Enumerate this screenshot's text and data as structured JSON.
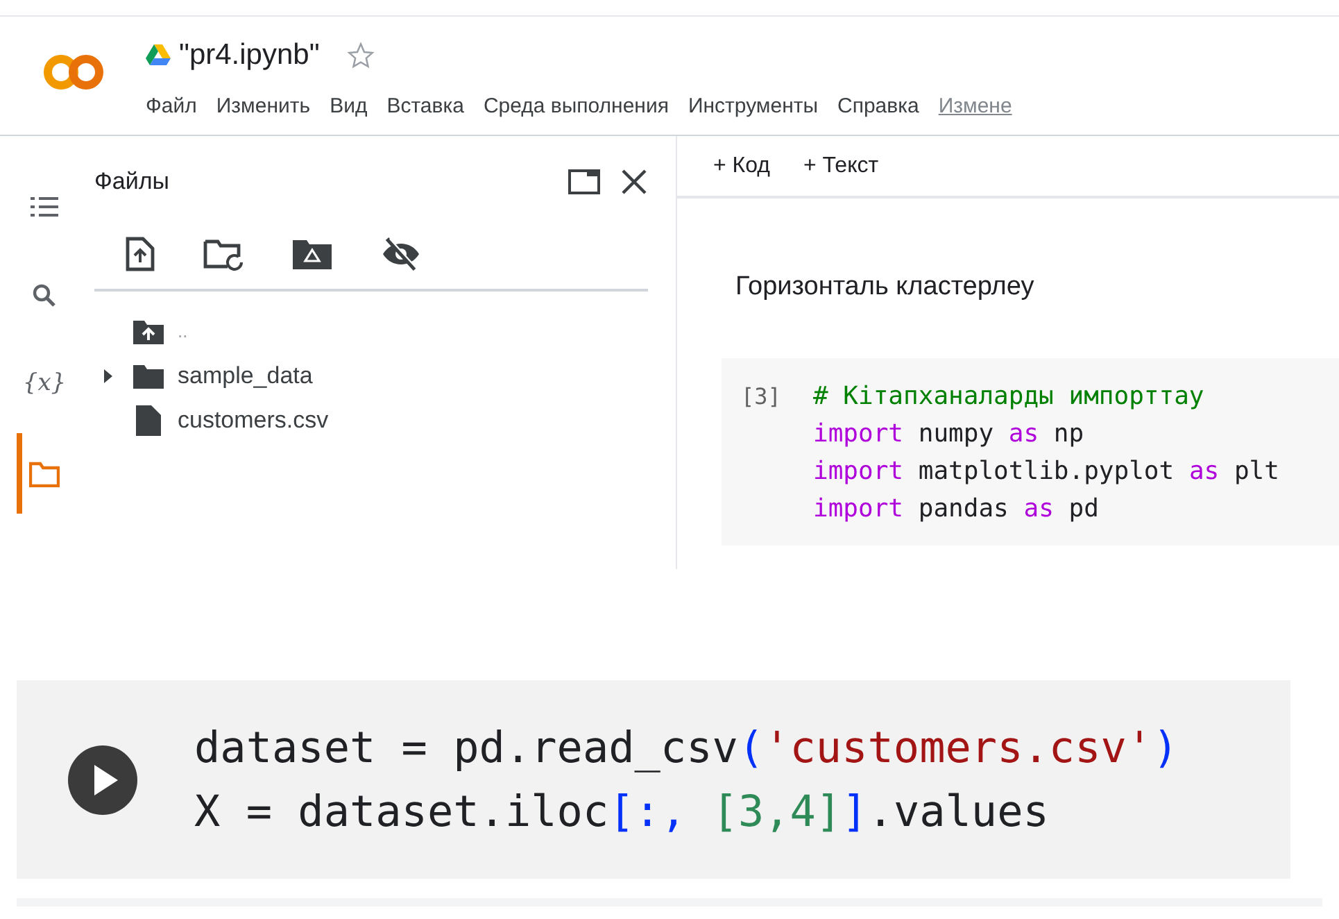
{
  "header": {
    "title": "\"pr4.ipynb\"",
    "starred": false,
    "menu": [
      {
        "label": "Файл",
        "kind": "menu"
      },
      {
        "label": "Изменить",
        "kind": "menu"
      },
      {
        "label": "Вид",
        "kind": "menu"
      },
      {
        "label": "Вставка",
        "kind": "menu"
      },
      {
        "label": "Среда выполнения",
        "kind": "menu"
      },
      {
        "label": "Инструменты",
        "kind": "menu"
      },
      {
        "label": "Справка",
        "kind": "menu"
      },
      {
        "label": "Измене",
        "kind": "link"
      }
    ]
  },
  "rail": [
    {
      "kind": "toc",
      "selected": false
    },
    {
      "kind": "search",
      "selected": false
    },
    {
      "kind": "variables",
      "glyph": "{x}",
      "selected": false
    },
    {
      "kind": "files",
      "selected": true
    }
  ],
  "files_panel": {
    "title": "Файлы",
    "tree": [
      {
        "kind": "parent",
        "label": ".."
      },
      {
        "kind": "folder",
        "label": "sample_data",
        "expanded": false
      },
      {
        "kind": "file",
        "label": "customers.csv"
      }
    ]
  },
  "notebook": {
    "toolbar": [
      {
        "label": "+ Код"
      },
      {
        "label": "+ Текст"
      }
    ],
    "heading": "Горизонталь кластерлеу",
    "cell": {
      "execution_count": "[3]",
      "lines": [
        [
          {
            "kind": "comment",
            "text": "# Кітапханаларды импорттау"
          }
        ],
        [
          {
            "kind": "keyword",
            "text": "import"
          },
          {
            "kind": "plain",
            "text": " numpy "
          },
          {
            "kind": "keyword",
            "text": "as"
          },
          {
            "kind": "plain",
            "text": " np"
          }
        ],
        [
          {
            "kind": "keyword",
            "text": "import"
          },
          {
            "kind": "plain",
            "text": " matplotlib.pyplot "
          },
          {
            "kind": "keyword",
            "text": "as"
          },
          {
            "kind": "plain",
            "text": " plt"
          }
        ],
        [
          {
            "kind": "keyword",
            "text": "import"
          },
          {
            "kind": "plain",
            "text": " pandas "
          },
          {
            "kind": "keyword",
            "text": "as"
          },
          {
            "kind": "plain",
            "text": " pd"
          }
        ]
      ]
    }
  },
  "active_cell": {
    "lines": [
      [
        {
          "kind": "plain",
          "text": "dataset = pd.read_csv"
        },
        {
          "kind": "bracket",
          "text": "("
        },
        {
          "kind": "string",
          "text": "'customers.csv'"
        },
        {
          "kind": "bracket",
          "text": ")"
        }
      ],
      [
        {
          "kind": "plain",
          "text": "X = dataset.iloc"
        },
        {
          "kind": "bracket",
          "text": "[:, "
        },
        {
          "kind": "number",
          "text": "[3,4]"
        },
        {
          "kind": "bracket",
          "text": "]"
        },
        {
          "kind": "plain",
          "text": ".values"
        }
      ]
    ]
  }
}
